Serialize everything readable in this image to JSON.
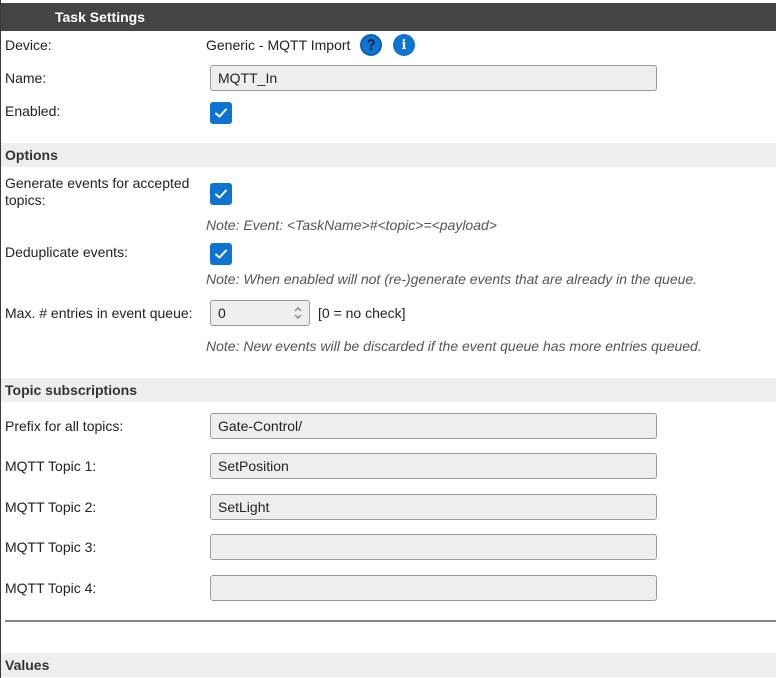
{
  "header": {
    "title": "Task Settings"
  },
  "device": {
    "label": "Device:",
    "value": "Generic - MQTT Import",
    "help_icon": "help-icon",
    "info_icon": "info-icon",
    "info_glyph": "i"
  },
  "name": {
    "label": "Name:",
    "value": "MQTT_In"
  },
  "enabled": {
    "label": "Enabled:",
    "checked": true
  },
  "options": {
    "title": "Options",
    "generate_events": {
      "label_line1": "Generate events for accepted",
      "label_line2": "topics:",
      "checked": true,
      "note": "Note: Event: <TaskName>#<topic>=<payload>"
    },
    "deduplicate": {
      "label": "Deduplicate events:",
      "checked": true,
      "note": "Note: When enabled will not (re-)generate events that are already in the queue."
    },
    "max_entries": {
      "label": "Max. # entries in event queue:",
      "value": "0",
      "hint": "[0 = no check]",
      "note": "Note: New events will be discarded if the event queue has more entries queued."
    }
  },
  "topics": {
    "title": "Topic subscriptions",
    "prefix": {
      "label": "Prefix for all topics:",
      "value": "Gate-Control/"
    },
    "topic1": {
      "label": "MQTT Topic 1:",
      "value": "SetPosition"
    },
    "topic2": {
      "label": "MQTT Topic 2:",
      "value": "SetLight"
    },
    "topic3": {
      "label": "MQTT Topic 3:",
      "value": ""
    },
    "topic4": {
      "label": "MQTT Topic 4:",
      "value": ""
    }
  },
  "values": {
    "title": "Values"
  },
  "colors": {
    "accent": "#0f73d1",
    "header_bg": "#444444",
    "section_bg": "#eeeeee"
  }
}
